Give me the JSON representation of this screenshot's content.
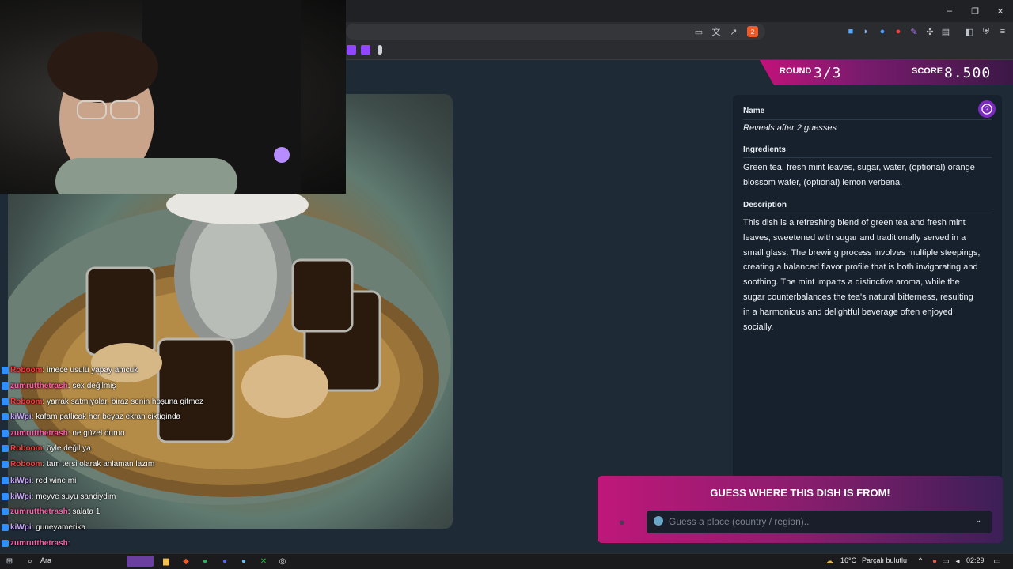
{
  "browser": {
    "window_controls": [
      "–",
      "❐",
      "✕"
    ],
    "extension_badge": "2"
  },
  "hud": {
    "round_label": "ROUND",
    "round_value": "3/3",
    "score_label": "SCORE",
    "score_value": "8.500",
    "accent_color": "#c2127a"
  },
  "panel": {
    "name_label": "Name",
    "name_value": "Reveals after 2 guesses",
    "ingredients_label": "Ingredients",
    "ingredients_lines": [
      "Green tea, fresh mint leaves, sugar, water, (optional) orange",
      "blossom water, (optional) lemon verbena."
    ],
    "description_label": "Description",
    "description_lines": [
      "This dish is a refreshing blend of green tea and fresh mint",
      "leaves, sweetened with sugar and traditionally served in a",
      "small glass. The brewing process involves multiple steepings,",
      "creating a balanced flavor profile that is both invigorating and",
      "soothing. The mint imparts a distinctive aroma, while the",
      "sugar counterbalances the tea's natural bitterness, resulting",
      "in a harmonious and delightful beverage often enjoyed",
      "socially."
    ],
    "help_icon": "question-circle-icon"
  },
  "guess": {
    "title": "GUESS WHERE THIS DISH IS FROM!",
    "placeholder": "Guess a place (country / region).."
  },
  "chat": [
    {
      "user": "Roboom",
      "color": "#ff3b3b",
      "message": ": imece usulü yapay amcuk"
    },
    {
      "user": "zumrutthetrash",
      "color": "#ff5ea8",
      "message": ": sex değilmiş"
    },
    {
      "user": "Roboom",
      "color": "#ff3b3b",
      "message": ": yarrak satmıyolar, biraz senin hoşuna gitmez"
    },
    {
      "user": "kiWpi",
      "color": "#c8a6ff",
      "message": ": kafam patlicak her beyaz ekran ciktiginda"
    },
    {
      "user": "zumrutthetrash",
      "color": "#ff5ea8",
      "message": ": ne güzel duruo"
    },
    {
      "user": "Roboom",
      "color": "#ff3b3b",
      "message": ": öyle değil ya"
    },
    {
      "user": "Roboom",
      "color": "#ff3b3b",
      "message": ": tam tersi olarak anlaman lazım"
    },
    {
      "user": "kiWpi",
      "color": "#c8a6ff",
      "message": ": red wine mi"
    },
    {
      "user": "kiWpi",
      "color": "#c8a6ff",
      "message": ": meyve suyu sandiydim"
    },
    {
      "user": "zumrutthetrash",
      "color": "#ff5ea8",
      "message": ": salata 1"
    },
    {
      "user": "kiWpi",
      "color": "#c8a6ff",
      "message": ": guneyamerika"
    },
    {
      "user": "zumrutthetrash",
      "color": "#ff5ea8",
      "message": ":"
    }
  ],
  "taskbar": {
    "search_label": "Ara",
    "weather": "16°C",
    "weather_desc": "Parçalı bulutlu",
    "time": "02:29"
  }
}
